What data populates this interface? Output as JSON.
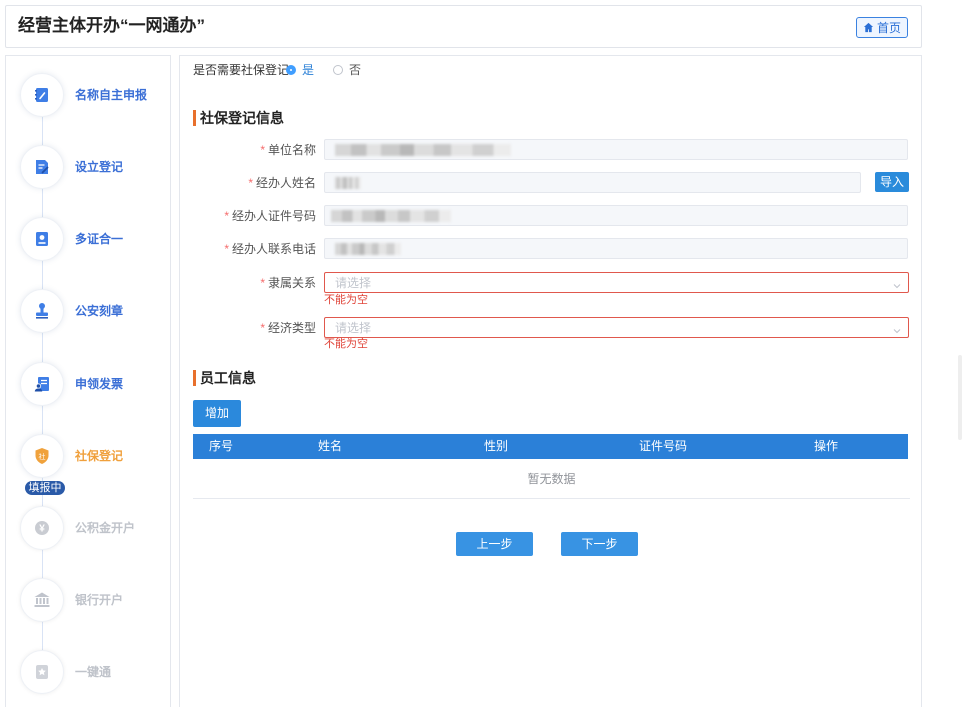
{
  "header": {
    "title": "经营主体开办“一网通办”",
    "home_label": "首页",
    "home_icon": "home-icon"
  },
  "steps": [
    {
      "label": "名称自主申报",
      "state": "done",
      "icon": "notebook-pen-icon"
    },
    {
      "label": "设立登记",
      "state": "done",
      "icon": "document-edit-icon"
    },
    {
      "label": "多证合一",
      "state": "done",
      "icon": "certificate-icon"
    },
    {
      "label": "公安刻章",
      "state": "done",
      "icon": "stamp-icon"
    },
    {
      "label": "申领发票",
      "state": "done",
      "icon": "invoice-icon"
    },
    {
      "label": "社保登记",
      "state": "active",
      "icon": "shield-icon",
      "icon_text": "社",
      "badge": "填报中"
    },
    {
      "label": "公积金开户",
      "state": "pending",
      "icon": "yen-coin-icon",
      "icon_text": "¥"
    },
    {
      "label": "银行开户",
      "state": "pending",
      "icon": "bank-icon"
    },
    {
      "label": "一键通",
      "state": "pending",
      "icon": "one-click-icon"
    }
  ],
  "social_security_question": {
    "label": "是否需要社保登记",
    "options": [
      {
        "label": "是",
        "checked": true
      },
      {
        "label": "否",
        "checked": false
      }
    ]
  },
  "social_security_section": {
    "title": "社保登记信息"
  },
  "form": {
    "required_mark": "*",
    "fields": [
      {
        "label": "单位名称",
        "type": "text",
        "disabled": true
      },
      {
        "label": "经办人姓名",
        "type": "text",
        "disabled": true,
        "action_label": "导入"
      },
      {
        "label": "经办人证件号码",
        "type": "text",
        "disabled": true
      },
      {
        "label": "经办人联系电话",
        "type": "text",
        "disabled": true
      },
      {
        "label": "隶属关系",
        "type": "select",
        "placeholder": "请选择",
        "error": "不能为空"
      },
      {
        "label": "经济类型",
        "type": "select",
        "placeholder": "请选择",
        "error": "不能为空"
      }
    ]
  },
  "employee_section": {
    "title": "员工信息",
    "add_label": "增加"
  },
  "employee_table": {
    "columns": [
      "序号",
      "姓名",
      "性别",
      "证件号码",
      "操作"
    ],
    "empty_text": "暂无数据"
  },
  "footer": {
    "prev_label": "上一步",
    "next_label": "下一步"
  },
  "colors": {
    "primary": "#2b80d8",
    "step_done": "#3b6fd6",
    "step_active": "#f0a03c",
    "step_pending": "#bfc3ca",
    "badge": "#2a5aa8",
    "section_bar": "#e8702c",
    "error": "#e0453a"
  }
}
